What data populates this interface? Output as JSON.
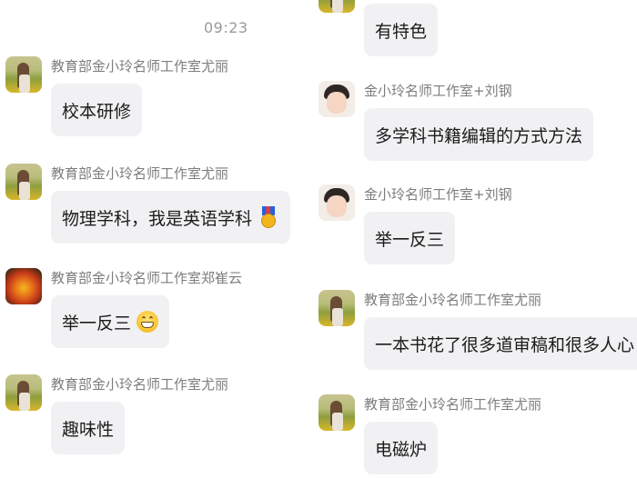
{
  "chat": {
    "timestamp": "09:23",
    "left_messages": [
      {
        "sender": "教育部金小玲名师工作室尤丽",
        "text": "校本研修",
        "avatar": "field-photo-avatar"
      },
      {
        "sender": "教育部金小玲名师工作室尤丽",
        "text": "物理学科，我是英语学科",
        "avatar": "field-photo-avatar",
        "emoji": "medal-icon"
      },
      {
        "sender": "教育部金小玲名师工作室郑崔云",
        "text": "举一反三",
        "avatar": "flower-photo-avatar",
        "emoji": "grinning-face-icon"
      },
      {
        "sender": "教育部金小玲名师工作室尤丽",
        "text": "趣味性",
        "avatar": "field-photo-avatar"
      }
    ],
    "right_messages": [
      {
        "sender": "",
        "text": "有特色",
        "avatar": "field-photo-avatar"
      },
      {
        "sender": "金小玲名师工作室+刘钢",
        "text": "多学科书籍编辑的方式方法",
        "avatar": "cartoon-avatar"
      },
      {
        "sender": "金小玲名师工作室+刘钢",
        "text": "举一反三",
        "avatar": "cartoon-avatar"
      },
      {
        "sender": "教育部金小玲名师工作室尤丽",
        "text": "一本书花了很多道审稿和很多人心",
        "avatar": "field-photo-avatar"
      },
      {
        "sender": "教育部金小玲名师工作室尤丽",
        "text": "电磁炉",
        "avatar": "field-photo-avatar"
      }
    ]
  }
}
